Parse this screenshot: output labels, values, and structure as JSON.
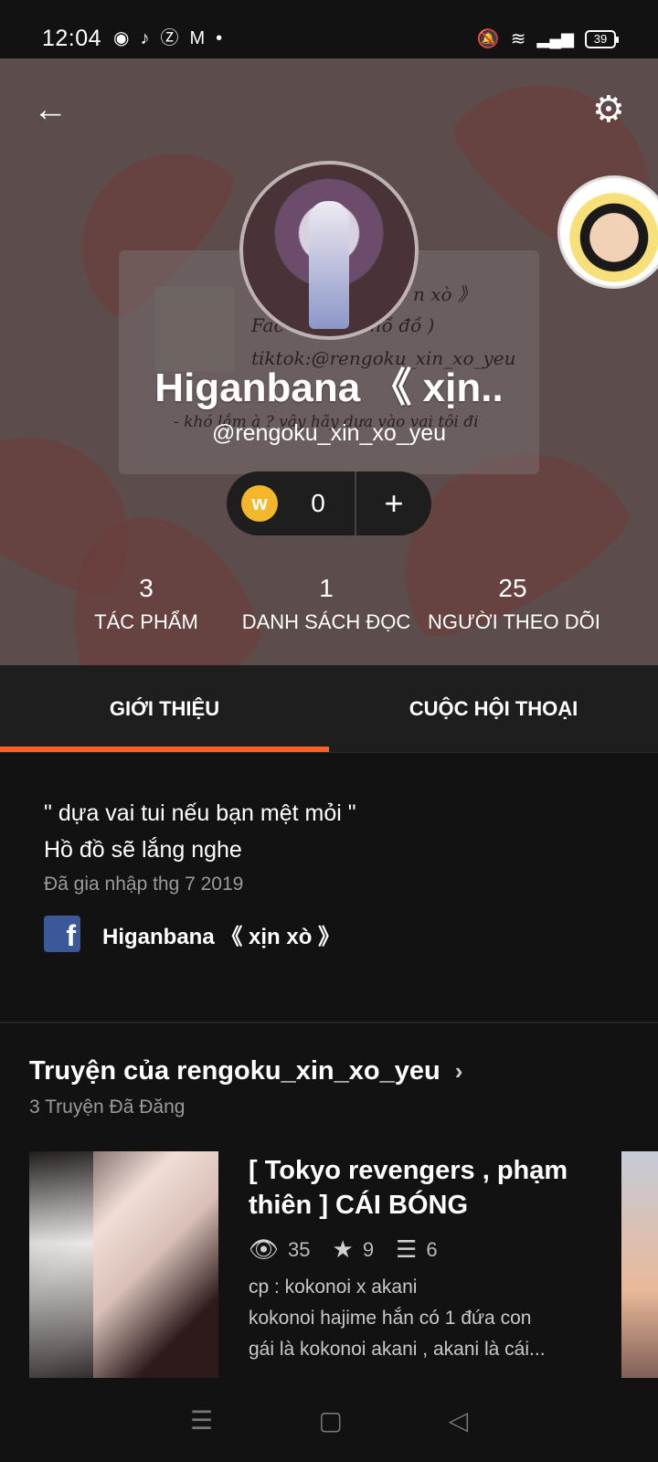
{
  "status_bar": {
    "time": "12:04",
    "battery": "39",
    "icons_left": [
      "media-icon",
      "tiktok-icon",
      "z-icon",
      "gmail-icon",
      "dot-icon"
    ],
    "icons_right": [
      "mute-icon",
      "wifi-icon",
      "signal-icon",
      "battery-icon"
    ]
  },
  "profile": {
    "display_name": "Higanbana 《 xịn..",
    "handle": "@rengoku_xin_xo_yeu",
    "coins": "0",
    "background_card_lines": [
      "n xò 》",
      "Fac          ư Trần ( hồ đồ )",
      "tiktok:@rengoku_xin_xo_yeu",
      "- khó lắm à ? vậy hãy dựa vào vai tôi đi"
    ]
  },
  "stats": [
    {
      "value": "3",
      "label": "TÁC PHẨM"
    },
    {
      "value": "1",
      "label": "DANH SÁCH ĐỌC"
    },
    {
      "value": "25",
      "label": "NGƯỜI THEO DÕI"
    }
  ],
  "tabs": [
    {
      "label": "GIỚI THIỆU",
      "active": true
    },
    {
      "label": "CUỘC HỘI THOẠI",
      "active": false
    }
  ],
  "about": {
    "bio_line1": "\" dựa vai tui nếu bạn mệt mỏi \"",
    "bio_line2": "Hồ đồ sẽ lắng nghe",
    "joined": "Đã gia nhập thg 7 2019",
    "facebook_name": "Higanbana 《 xịn xò 》"
  },
  "stories": {
    "title": "Truyện của rengoku_xin_xo_yeu",
    "subtitle": "3 Truyện Đã Đăng",
    "items": [
      {
        "title": "[ Tokyo revengers , phạm thiên ] CÁI BÓNG",
        "reads": "35",
        "votes": "9",
        "parts": "6",
        "desc_line1": "cp : kokonoi x akani",
        "desc_line2": "kokonoi hajime hắn có 1 đứa con",
        "desc_line3": "gái là kokonoi akani , akani là cái..."
      }
    ]
  },
  "colors": {
    "accent": "#ff6122",
    "background": "#121212",
    "header_bg": "#5c4c4c",
    "coin": "#f5b72a",
    "facebook": "#3b5998"
  }
}
